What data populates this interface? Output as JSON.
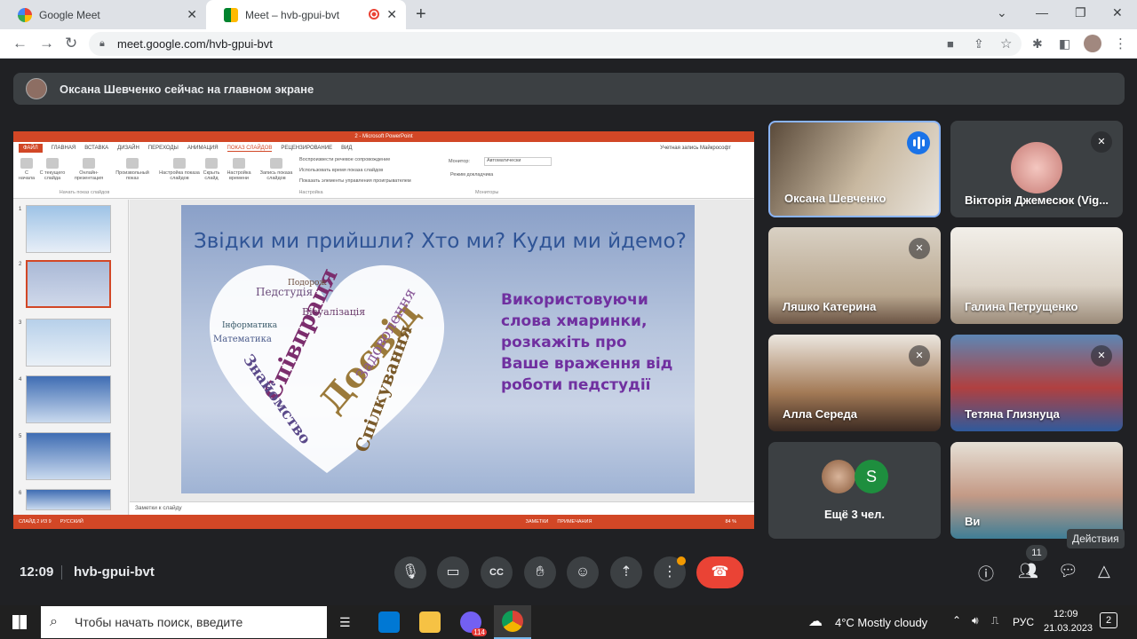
{
  "browser": {
    "tabs": [
      {
        "title": "Google Meet",
        "active": false
      },
      {
        "title": "Meet – hvb-gpui-bvt",
        "active": true
      }
    ],
    "url": "meet.google.com/hvb-gpui-bvt"
  },
  "banner": {
    "text": "Оксана Шевченко сейчас на главном экране"
  },
  "ppt": {
    "window_title": "2 - Microsoft PowerPoint",
    "menu": [
      "ФАЙЛ",
      "ГЛАВНАЯ",
      "ВСТАВКА",
      "ДИЗАЙН",
      "ПЕРЕХОДЫ",
      "АНИМАЦИЯ",
      "ПОКАЗ СЛАЙДОВ",
      "РЕЦЕНЗИРОВАНИЕ",
      "ВИД"
    ],
    "account": "Учетная запись Майкрософт",
    "ribbon": {
      "from_start": "С начала",
      "from_current": "С текущего слайда",
      "online": "Онлайн-презентация",
      "custom": "Произвольный показ",
      "group1": "Начать показ слайдов",
      "setup": "Настройка показа слайдов",
      "hide": "Скрыть слайд",
      "timing": "Настройка времени",
      "record": "Запись показа слайдов",
      "play_narr": "Воспроизвести речевое сопровождение",
      "use_timing": "Использовать время показа слайдов",
      "show_ctrls": "Показать элементы управления проигрывателем",
      "group2": "Настройка",
      "monitor_label": "Монитор:",
      "monitor_value": "Автоматически",
      "presenter": "Режим докладчика",
      "group3": "Мониторы"
    },
    "thumb_numbers": [
      "1",
      "2",
      "3",
      "4",
      "5",
      "6"
    ],
    "slide": {
      "title": "Звідки ми прийшли? Хто ми? Куди ми йдемо?",
      "lines": [
        "Використовуючи",
        "слова хмаринки,",
        "розкажіть про",
        "Ваше враження від",
        "роботи педстудії"
      ],
      "cloud_words": [
        "Досвід",
        "Спілкування",
        "Співпраця",
        "Знайомство",
        "Задоволення",
        "Педстудія",
        "Математика",
        "Візуалізація",
        "Інформатика",
        "Подорож"
      ]
    },
    "notes": "Заметки к слайду",
    "status": {
      "slide": "СЛАЙД 2 ИЗ 9",
      "lang": "РУССКИЙ",
      "notes": "ЗАМЕТКИ",
      "comments": "ПРИМЕЧАНИЯ",
      "zoom": "84 %"
    }
  },
  "tiles": [
    {
      "name": "Оксана Шевченко"
    },
    {
      "name": "Вікторія Джемесюк (Vig..."
    },
    {
      "name": "Ляшко Катерина"
    },
    {
      "name": "Галина Петрущенко"
    },
    {
      "name": "Алла Середа"
    },
    {
      "name": "Тетяна Глизнуца"
    },
    {
      "name": "Ещё 3 чел.",
      "initial": "S"
    },
    {
      "name": "Ви"
    }
  ],
  "controls": {
    "time": "12:09",
    "code": "hvb-gpui-bvt",
    "participants_count": "11",
    "tooltip": "Действия"
  },
  "taskbar": {
    "search_placeholder": "Чтобы начать поиск, введите",
    "weather": "4°C  Mostly cloudy",
    "lang": "РУС",
    "time": "12:09",
    "date": "21.03.2023",
    "viber_badge": "114",
    "notif_count": "2"
  },
  "colors": {
    "meet_bg": "#202124",
    "tile_bg": "#3c4043",
    "end_call": "#ea4335",
    "speaking": "#1a73e8",
    "ppt_accent": "#d24726"
  }
}
